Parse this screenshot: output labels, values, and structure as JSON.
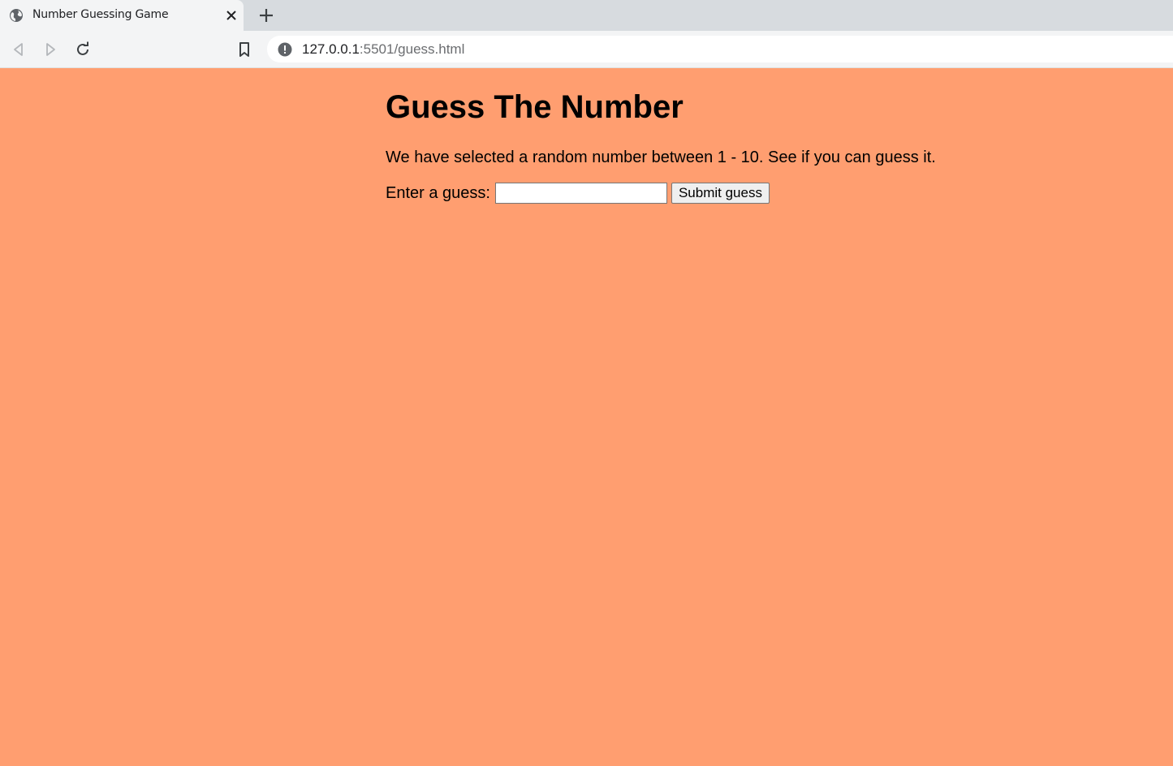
{
  "browser": {
    "tab_title": "Number Guessing Game",
    "url_host": "127.0.0.1",
    "url_rest": ":5501/guess.html",
    "icons": [
      "globe-icon",
      "close-icon",
      "plus-icon",
      "back-arrow-icon",
      "forward-arrow-icon",
      "reload-icon",
      "bookmark-icon",
      "info-icon"
    ]
  },
  "page": {
    "background_color": "#ff9e70",
    "title": "Guess The Number",
    "description": "We have selected a random number between 1 - 10. See if you can guess it.",
    "guess_label": "Enter a guess:",
    "guess_value": "",
    "submit_label": "Submit guess"
  }
}
